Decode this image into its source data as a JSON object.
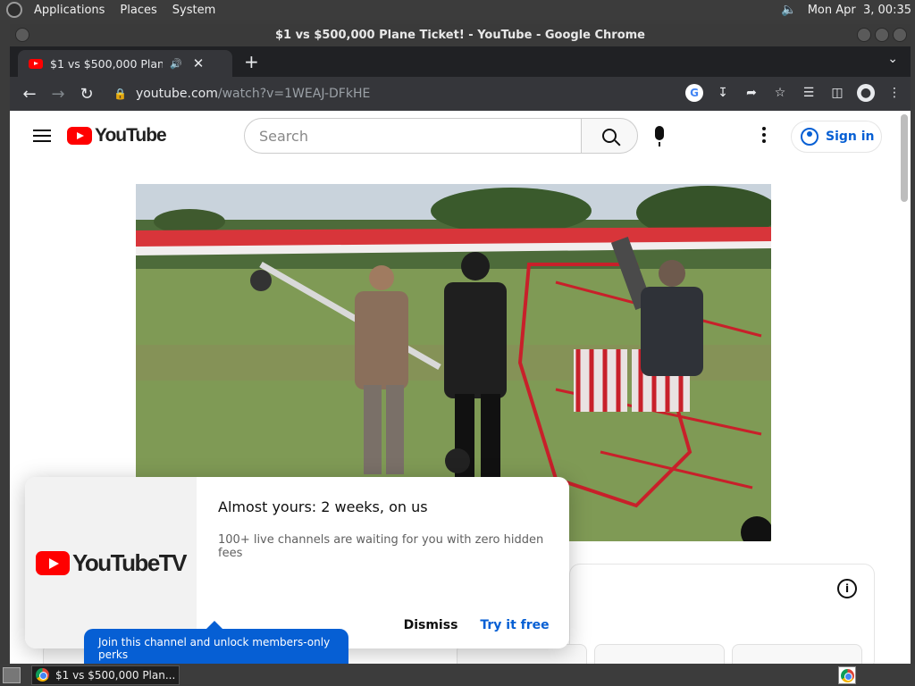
{
  "panel": {
    "menus": [
      "Applications",
      "Places",
      "System"
    ],
    "clock": "Mon Apr  3, 00:35"
  },
  "window": {
    "title": "$1 vs $500,000 Plane Ticket! - YouTube - Google Chrome"
  },
  "tab": {
    "title": "$1 vs $500,000 Plane Ticket! - YouTube"
  },
  "omnibox": {
    "host": "youtube.com",
    "path": "/watch?v=1WEAJ-DFkHE"
  },
  "youtube": {
    "logo_text": "YouTube",
    "search_placeholder": "Search",
    "signin_label": "Sign in"
  },
  "promo": {
    "logo_text": "YouTubeTV",
    "title": "Almost yours: 2 weeks, on us",
    "body": "100+ live channels are waiting for you with zero hidden fees",
    "dismiss_label": "Dismiss",
    "try_label": "Try it free"
  },
  "tooltip": {
    "text": "Join this channel and unlock members-only perks"
  },
  "taskbar": {
    "task_label": "$1 vs $500,000 Plan..."
  },
  "colors": {
    "youtube_red": "#ff0000",
    "link_blue": "#065fd4",
    "chrome_dark": "#35363a"
  }
}
